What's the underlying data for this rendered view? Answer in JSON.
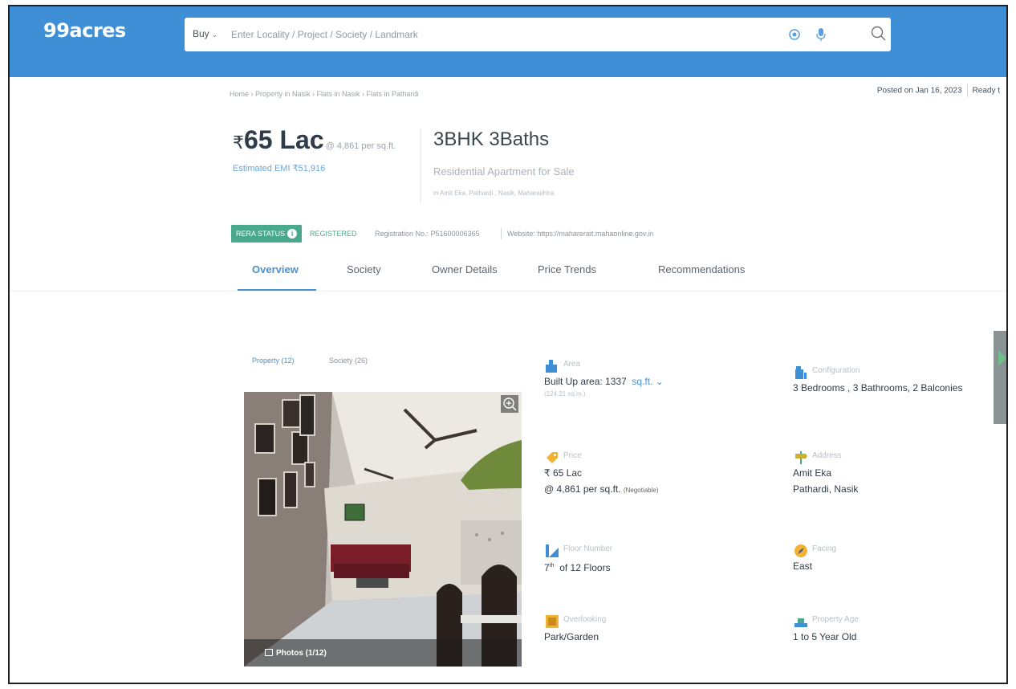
{
  "header": {
    "logo": "99acres",
    "buy_label": "Buy",
    "search_placeholder": "Enter Locality / Project / Society / Landmark"
  },
  "breadcrumb": "Home › Property in Nasik › Flats in Nasik › Flats in Pathardi",
  "posted": {
    "date": "Posted on Jan 16, 2023",
    "status": "Ready t"
  },
  "listing": {
    "currency": "₹",
    "price": "65 Lac",
    "per_sqft": "@ 4,861 per sq.ft.",
    "emi": "Estimated EMI ₹51,916",
    "title": "3BHK 3Baths",
    "subtitle": "Residential Apartment for Sale",
    "location": "in Amit Eka, Pathardi , Nasik, Maharashtra"
  },
  "rera": {
    "badge": "RERA STATUS",
    "status": "REGISTERED",
    "registration": "Registration No.: P51600006365",
    "website": "Website: https://maharerait.mahaonline.gov.in"
  },
  "tabs": [
    "Overview",
    "Society",
    "Owner Details",
    "Price Trends",
    "Recommendations"
  ],
  "gallery": {
    "property_tab": "Property (12)",
    "society_tab": "Society (26)",
    "photos_label": "Photos (1/12)"
  },
  "specs": {
    "area": {
      "label": "Area",
      "value": "Built Up area: 1337",
      "unit": "sq.ft.",
      "sub": "(124.21 sq.m.)"
    },
    "configuration": {
      "label": "Configuration",
      "value": "3 Bedrooms , 3 Bathrooms, 2 Balconies"
    },
    "price": {
      "label": "Price",
      "value": "₹ 65 Lac",
      "per": "@ 4,861 per sq.ft.",
      "note": "(Negotiable)"
    },
    "address": {
      "label": "Address",
      "line1": "Amit Eka",
      "line2": "Pathardi, Nasik"
    },
    "floor": {
      "label": "Floor Number",
      "floor": "7",
      "suffix": "th",
      "rest": "of 12 Floors"
    },
    "facing": {
      "label": "Facing",
      "value": "East"
    },
    "overlooking": {
      "label": "Overlooking",
      "value": "Park/Garden"
    },
    "age": {
      "label": "Property Age",
      "value": "1 to 5 Year Old"
    }
  },
  "colors": {
    "header_blue": "#3f8fd6",
    "link_blue": "#4d8fcf",
    "rera_green": "#4aa88c"
  }
}
